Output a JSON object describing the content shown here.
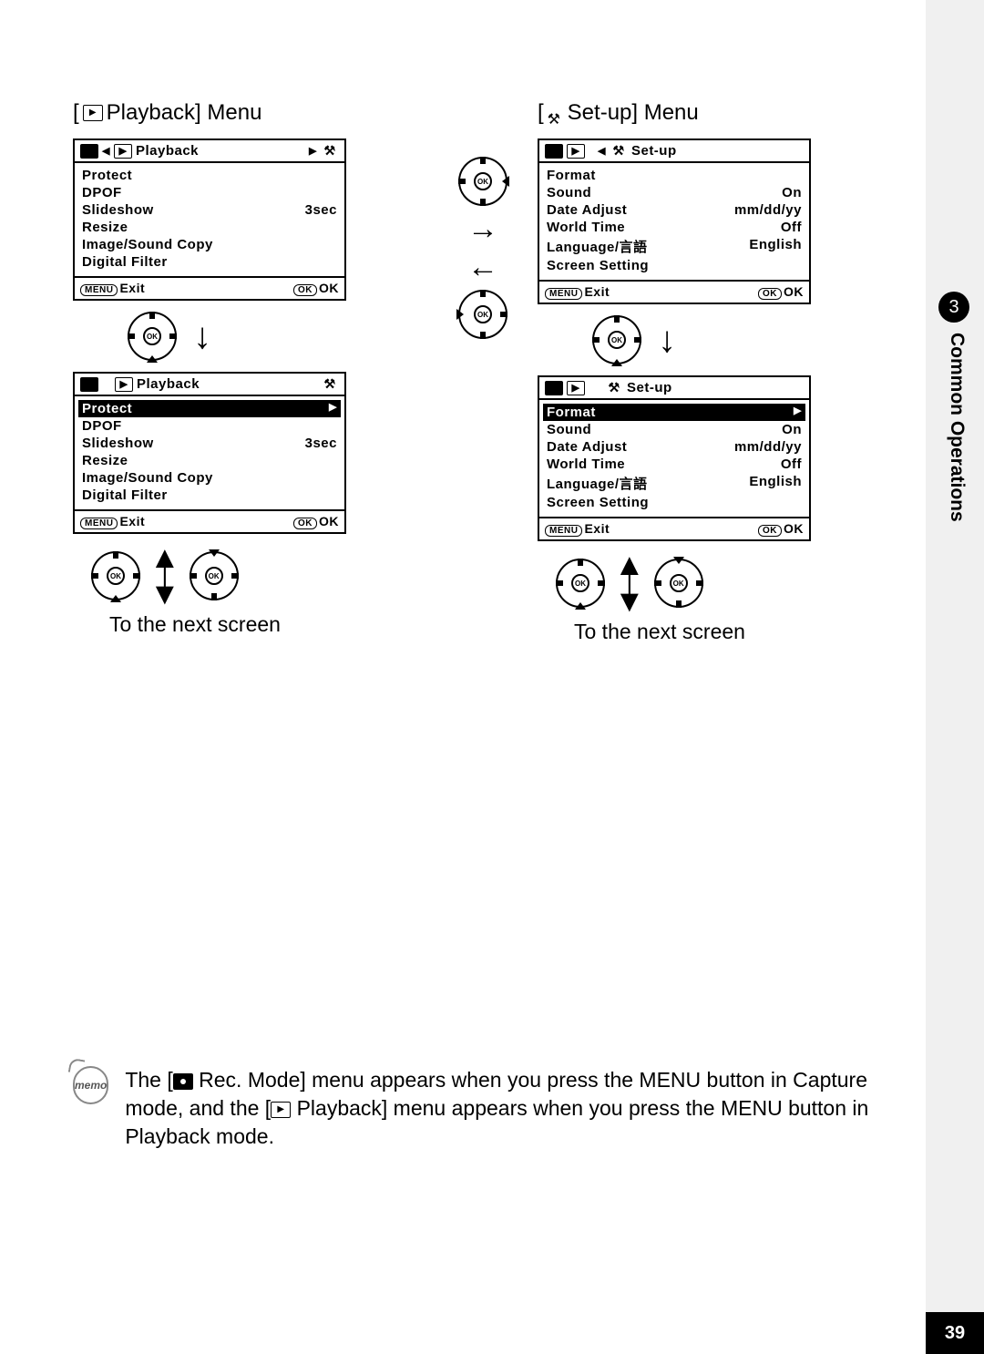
{
  "page_number": "39",
  "chapter": {
    "number": "3",
    "label": "Common Operations"
  },
  "left": {
    "title": "Playback] Menu",
    "screen1": {
      "header": "Playback",
      "items": [
        {
          "label": "Protect",
          "value": ""
        },
        {
          "label": "DPOF",
          "value": ""
        },
        {
          "label": "Slideshow",
          "value": "3sec"
        },
        {
          "label": "Resize",
          "value": ""
        },
        {
          "label": "Image/Sound Copy",
          "value": ""
        },
        {
          "label": "Digital Filter",
          "value": ""
        }
      ],
      "footer": {
        "exit": "Exit",
        "ok": "OK"
      }
    },
    "screen2": {
      "header": "Playback",
      "highlight": "Protect",
      "items": [
        {
          "label": "DPOF",
          "value": ""
        },
        {
          "label": "Slideshow",
          "value": "3sec"
        },
        {
          "label": "Resize",
          "value": ""
        },
        {
          "label": "Image/Sound Copy",
          "value": ""
        },
        {
          "label": "Digital Filter",
          "value": ""
        }
      ],
      "footer": {
        "exit": "Exit",
        "ok": "OK"
      }
    },
    "next": "To the next screen"
  },
  "right": {
    "title": "Set-up] Menu",
    "screen1": {
      "header": "Set-up",
      "items": [
        {
          "label": "Format",
          "value": ""
        },
        {
          "label": "Sound",
          "value": "On"
        },
        {
          "label": "Date Adjust",
          "value": "mm/dd/yy"
        },
        {
          "label": "World Time",
          "value": "Off"
        },
        {
          "label": "Language/言語",
          "value": "English"
        },
        {
          "label": "Screen Setting",
          "value": ""
        }
      ],
      "footer": {
        "exit": "Exit",
        "ok": "OK"
      }
    },
    "screen2": {
      "header": "Set-up",
      "highlight": "Format",
      "items": [
        {
          "label": "Sound",
          "value": "On"
        },
        {
          "label": "Date Adjust",
          "value": "mm/dd/yy"
        },
        {
          "label": "World Time",
          "value": "Off"
        },
        {
          "label": "Language/言語",
          "value": "English"
        },
        {
          "label": "Screen Setting",
          "value": ""
        }
      ],
      "footer": {
        "exit": "Exit",
        "ok": "OK"
      }
    },
    "next": "To the next screen"
  },
  "memo": {
    "label": "memo",
    "text_a": "The [",
    "text_b": " Rec. Mode] menu appears when you press the MENU button in Capture mode, and the [",
    "text_c": " Playback] menu appears when you press the MENU button in Playback mode."
  },
  "labels": {
    "menu_btn": "MENU",
    "ok_btn": "OK"
  }
}
